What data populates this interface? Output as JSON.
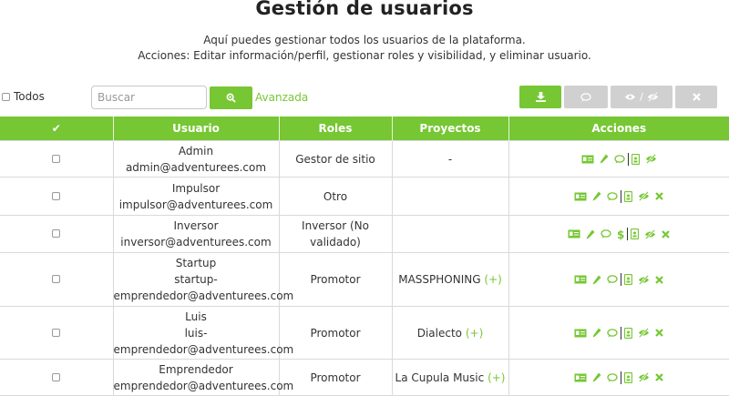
{
  "header": {
    "title": "Gestión de usuarios",
    "subtitle_line1": "Aquí puedes gestionar todos los usuarios de la plataforma.",
    "subtitle_line2": "Acciones: Editar información/perfil, gestionar roles y visibilidad, y eliminar usuario."
  },
  "toolbar": {
    "select_all_label": "Todos",
    "search_placeholder": "Buscar",
    "advanced_label": "Avanzada",
    "visibility_sep": "/"
  },
  "colors": {
    "accent": "#76c733",
    "disabled": "#d0d0d0",
    "border": "#d9d9d9"
  },
  "table": {
    "headers": {
      "check": "✔",
      "user": "Usuario",
      "roles": "Roles",
      "projects": "Proyectos",
      "actions": "Acciones"
    },
    "rows": [
      {
        "name": "Admin",
        "email": "admin@adventurees.com",
        "role": "Gestor de sitio",
        "project": "-",
        "project_plus": "",
        "actions": [
          "card",
          "edit",
          "chat",
          "sep",
          "badge",
          "eye"
        ]
      },
      {
        "name": "Impulsor",
        "email": "impulsor@adventurees.com",
        "role": "Otro",
        "project": "",
        "project_plus": "",
        "actions": [
          "card",
          "edit",
          "chat",
          "sep",
          "badge",
          "eye",
          "delete"
        ]
      },
      {
        "name": "Inversor",
        "email": "inversor@adventurees.com",
        "role": "Inversor (No validado)",
        "project": "",
        "project_plus": "",
        "actions": [
          "card",
          "edit",
          "chat",
          "dollar",
          "sep",
          "badge",
          "eye",
          "delete"
        ]
      },
      {
        "name": "Startup",
        "email": "startup-",
        "email2": "emprendedor@adventurees.com",
        "role": "Promotor",
        "project": "MASSPHONING",
        "project_plus": "(+)",
        "actions": [
          "card",
          "edit",
          "chat",
          "sep",
          "badge",
          "eye",
          "delete"
        ]
      },
      {
        "name": "Luis",
        "email": "luis-",
        "email2": "emprendedor@adventurees.com",
        "role": "Promotor",
        "project": "Dialecto",
        "project_plus": "(+)",
        "actions": [
          "card",
          "edit",
          "chat",
          "sep",
          "badge",
          "eye",
          "delete"
        ]
      },
      {
        "name": "Emprendedor",
        "email": "emprendedor@adventurees.com",
        "role": "Promotor",
        "project": "La Cupula Music",
        "project_plus": "(+)",
        "actions": [
          "card",
          "edit",
          "chat",
          "sep",
          "badge",
          "eye",
          "delete"
        ]
      }
    ]
  }
}
